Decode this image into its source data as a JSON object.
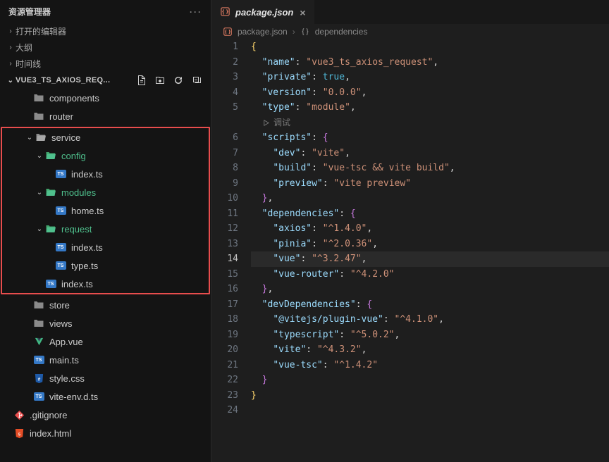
{
  "explorer": {
    "title": "资源管理器",
    "sections": {
      "open_editors": "打开的编辑器",
      "outline": "大纲",
      "timeline": "时间线"
    },
    "project": "VUE3_TS_AXIOS_REQ...",
    "tree": [
      {
        "type": "folder-closed",
        "label": "components",
        "depth": 0,
        "chev": ""
      },
      {
        "type": "folder-closed",
        "label": "router",
        "depth": 0,
        "chev": ""
      },
      {
        "type": "folder-open",
        "label": "service",
        "depth": 0,
        "chev": "down",
        "hl": "start"
      },
      {
        "type": "folder-open-g",
        "label": "config",
        "depth": 1,
        "chev": "down"
      },
      {
        "type": "ts",
        "label": "index.ts",
        "depth": 2,
        "chev": ""
      },
      {
        "type": "folder-open-g",
        "label": "modules",
        "depth": 1,
        "chev": "down"
      },
      {
        "type": "ts",
        "label": "home.ts",
        "depth": 2,
        "chev": ""
      },
      {
        "type": "folder-open-g",
        "label": "request",
        "depth": 1,
        "chev": "down"
      },
      {
        "type": "ts",
        "label": "index.ts",
        "depth": 2,
        "chev": ""
      },
      {
        "type": "ts",
        "label": "type.ts",
        "depth": 2,
        "chev": ""
      },
      {
        "type": "ts",
        "label": "index.ts",
        "depth": 1,
        "chev": "",
        "hl": "end"
      },
      {
        "type": "folder-closed",
        "label": "store",
        "depth": 0,
        "chev": ""
      },
      {
        "type": "folder-closed",
        "label": "views",
        "depth": 0,
        "chev": ""
      },
      {
        "type": "vue",
        "label": "App.vue",
        "depth": 0,
        "chev": ""
      },
      {
        "type": "ts",
        "label": "main.ts",
        "depth": 0,
        "chev": ""
      },
      {
        "type": "css",
        "label": "style.css",
        "depth": 0,
        "chev": ""
      },
      {
        "type": "ts",
        "label": "vite-env.d.ts",
        "depth": 0,
        "chev": ""
      },
      {
        "type": "git",
        "label": ".gitignore",
        "depth": -1,
        "chev": ""
      },
      {
        "type": "html",
        "label": "index.html",
        "depth": -1,
        "chev": ""
      }
    ]
  },
  "tab": {
    "filename": "package.json"
  },
  "breadcrumb": {
    "file": "package.json",
    "symbol": "dependencies"
  },
  "debug_hint": "调试",
  "code": {
    "active_line": 14,
    "lines": [
      {
        "n": 1,
        "indent": 0,
        "tokens": [
          [
            "p-brace",
            "{"
          ]
        ]
      },
      {
        "n": 2,
        "indent": 1,
        "tokens": [
          [
            "p-key",
            "\"name\""
          ],
          [
            "p-punc",
            ": "
          ],
          [
            "p-str",
            "\"vue3_ts_axios_request\""
          ],
          [
            "p-punc",
            ","
          ]
        ]
      },
      {
        "n": 3,
        "indent": 1,
        "tokens": [
          [
            "p-key",
            "\"private\""
          ],
          [
            "p-punc",
            ": "
          ],
          [
            "p-bool",
            "true"
          ],
          [
            "p-punc",
            ","
          ]
        ]
      },
      {
        "n": 4,
        "indent": 1,
        "tokens": [
          [
            "p-key",
            "\"version\""
          ],
          [
            "p-punc",
            ": "
          ],
          [
            "p-str",
            "\"0.0.0\""
          ],
          [
            "p-punc",
            ","
          ]
        ]
      },
      {
        "n": 5,
        "indent": 1,
        "tokens": [
          [
            "p-key",
            "\"type\""
          ],
          [
            "p-punc",
            ": "
          ],
          [
            "p-str",
            "\"module\""
          ],
          [
            "p-punc",
            ","
          ]
        ]
      },
      {
        "n": "debug"
      },
      {
        "n": 6,
        "indent": 1,
        "tokens": [
          [
            "p-key",
            "\"scripts\""
          ],
          [
            "p-punc",
            ": "
          ],
          [
            "p-brace2",
            "{"
          ]
        ]
      },
      {
        "n": 7,
        "indent": 2,
        "tokens": [
          [
            "p-key",
            "\"dev\""
          ],
          [
            "p-punc",
            ": "
          ],
          [
            "p-str",
            "\"vite\""
          ],
          [
            "p-punc",
            ","
          ]
        ]
      },
      {
        "n": 8,
        "indent": 2,
        "tokens": [
          [
            "p-key",
            "\"build\""
          ],
          [
            "p-punc",
            ": "
          ],
          [
            "p-str",
            "\"vue-tsc && vite build\""
          ],
          [
            "p-punc",
            ","
          ]
        ]
      },
      {
        "n": 9,
        "indent": 2,
        "tokens": [
          [
            "p-key",
            "\"preview\""
          ],
          [
            "p-punc",
            ": "
          ],
          [
            "p-str",
            "\"vite preview\""
          ]
        ]
      },
      {
        "n": 10,
        "indent": 1,
        "tokens": [
          [
            "p-brace2",
            "}"
          ],
          [
            "p-punc",
            ","
          ]
        ]
      },
      {
        "n": 11,
        "indent": 1,
        "tokens": [
          [
            "p-key",
            "\"dependencies\""
          ],
          [
            "p-punc",
            ": "
          ],
          [
            "p-brace2",
            "{"
          ]
        ]
      },
      {
        "n": 12,
        "indent": 2,
        "tokens": [
          [
            "p-key",
            "\"axios\""
          ],
          [
            "p-punc",
            ": "
          ],
          [
            "p-str",
            "\"^1.4.0\""
          ],
          [
            "p-punc",
            ","
          ]
        ]
      },
      {
        "n": 13,
        "indent": 2,
        "tokens": [
          [
            "p-key",
            "\"pinia\""
          ],
          [
            "p-punc",
            ": "
          ],
          [
            "p-str",
            "\"^2.0.36\""
          ],
          [
            "p-punc",
            ","
          ]
        ]
      },
      {
        "n": 14,
        "indent": 2,
        "tokens": [
          [
            "p-key",
            "\"vue\""
          ],
          [
            "p-punc",
            ": "
          ],
          [
            "p-str",
            "\"^3.2.47\""
          ],
          [
            "p-punc",
            ","
          ]
        ]
      },
      {
        "n": 15,
        "indent": 2,
        "tokens": [
          [
            "p-key",
            "\"vue-router\""
          ],
          [
            "p-punc",
            ": "
          ],
          [
            "p-str",
            "\"^4.2.0\""
          ]
        ]
      },
      {
        "n": 16,
        "indent": 1,
        "tokens": [
          [
            "p-brace2",
            "}"
          ],
          [
            "p-punc",
            ","
          ]
        ]
      },
      {
        "n": 17,
        "indent": 1,
        "tokens": [
          [
            "p-key",
            "\"devDependencies\""
          ],
          [
            "p-punc",
            ": "
          ],
          [
            "p-brace2",
            "{"
          ]
        ]
      },
      {
        "n": 18,
        "indent": 2,
        "tokens": [
          [
            "p-key",
            "\"@vitejs/plugin-vue\""
          ],
          [
            "p-punc",
            ": "
          ],
          [
            "p-str",
            "\"^4.1.0\""
          ],
          [
            "p-punc",
            ","
          ]
        ]
      },
      {
        "n": 19,
        "indent": 2,
        "tokens": [
          [
            "p-key",
            "\"typescript\""
          ],
          [
            "p-punc",
            ": "
          ],
          [
            "p-str",
            "\"^5.0.2\""
          ],
          [
            "p-punc",
            ","
          ]
        ]
      },
      {
        "n": 20,
        "indent": 2,
        "tokens": [
          [
            "p-key",
            "\"vite\""
          ],
          [
            "p-punc",
            ": "
          ],
          [
            "p-str",
            "\"^4.3.2\""
          ],
          [
            "p-punc",
            ","
          ]
        ]
      },
      {
        "n": 21,
        "indent": 2,
        "tokens": [
          [
            "p-key",
            "\"vue-tsc\""
          ],
          [
            "p-punc",
            ": "
          ],
          [
            "p-str",
            "\"^1.4.2\""
          ]
        ]
      },
      {
        "n": 22,
        "indent": 1,
        "tokens": [
          [
            "p-brace2",
            "}"
          ]
        ]
      },
      {
        "n": 23,
        "indent": 0,
        "tokens": [
          [
            "p-brace",
            "}"
          ]
        ]
      },
      {
        "n": 24,
        "indent": 0,
        "tokens": []
      }
    ]
  }
}
